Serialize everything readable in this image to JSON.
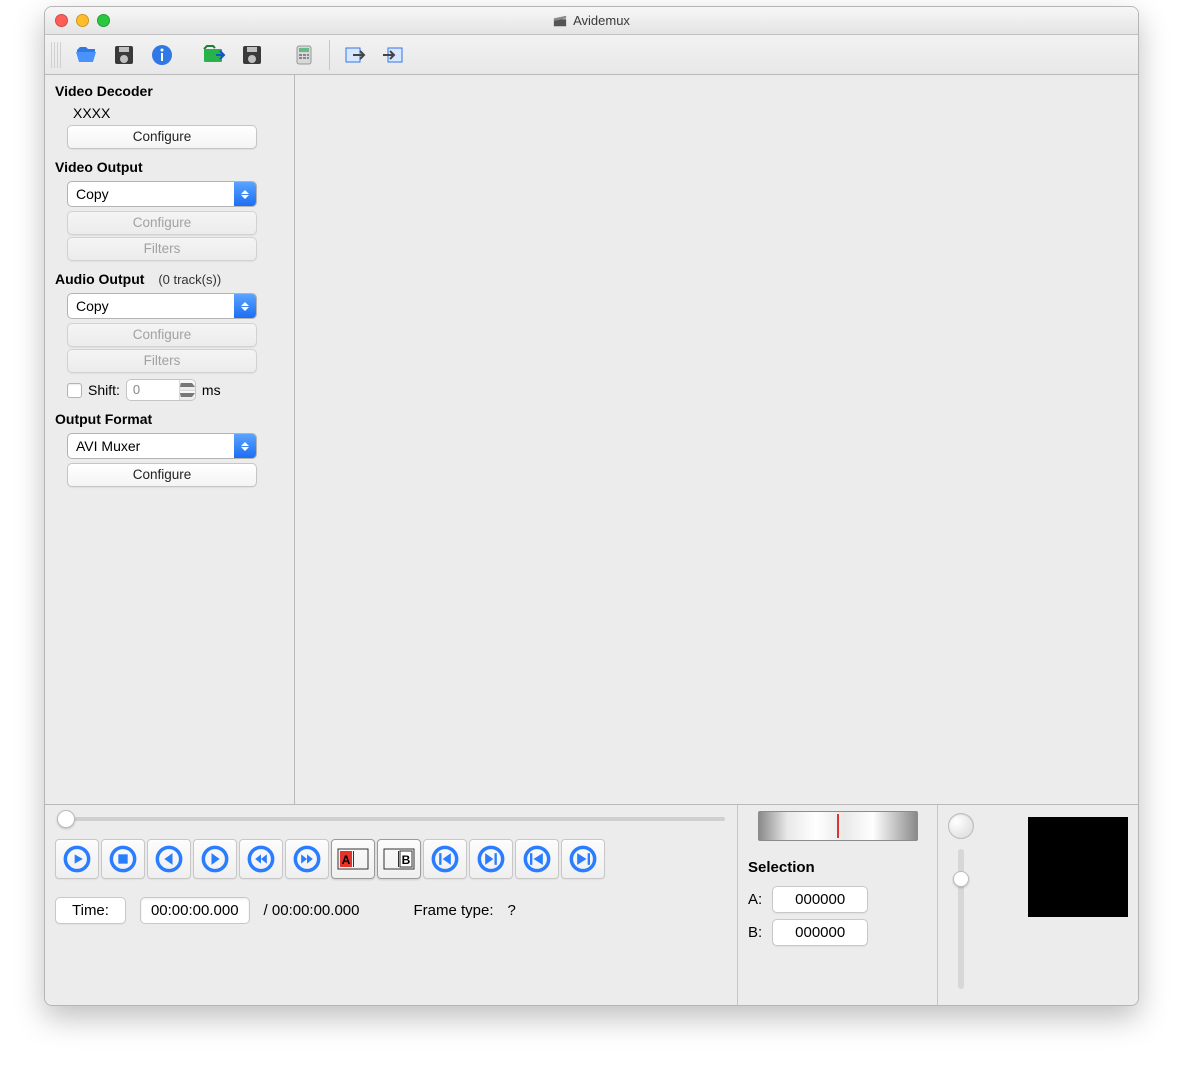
{
  "window": {
    "title": "Avidemux"
  },
  "toolbar_icons": [
    "open",
    "save",
    "info",
    "folder-in",
    "disk",
    "calculator",
    "jump-in",
    "jump-out"
  ],
  "sidebar": {
    "video_decoder": {
      "title": "Video Decoder",
      "codec": "XXXX",
      "configure": "Configure"
    },
    "video_output": {
      "title": "Video Output",
      "selected": "Copy",
      "configure": "Configure",
      "filters": "Filters"
    },
    "audio_output": {
      "title": "Audio Output",
      "tracks_suffix": "(0 track(s))",
      "selected": "Copy",
      "configure": "Configure",
      "filters": "Filters",
      "shift_label": "Shift:",
      "shift_value": "0",
      "shift_unit": "ms"
    },
    "output_format": {
      "title": "Output Format",
      "selected": "AVI Muxer",
      "configure": "Configure"
    }
  },
  "playbar_icons": [
    "play",
    "stop",
    "prev-frame",
    "next-frame",
    "rewind",
    "forward",
    "marker-a",
    "marker-b",
    "goto-a",
    "goto-b",
    "prev-key",
    "next-key"
  ],
  "time": {
    "label": "Time:",
    "current": "00:00:00.000",
    "total_prefix": "/ ",
    "total": "00:00:00.000",
    "frame_type_label": "Frame type:",
    "frame_type": "?"
  },
  "selection": {
    "title": "Selection",
    "a_label": "A:",
    "a": "000000",
    "b_label": "B:",
    "b": "000000"
  }
}
